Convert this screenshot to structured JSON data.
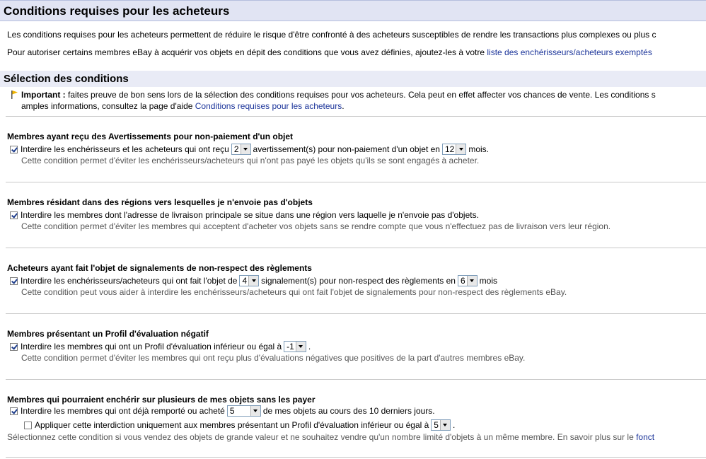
{
  "page": {
    "title": "Conditions requises pour les acheteurs",
    "intro1": "Les conditions requises pour les acheteurs permettent de réduire le risque d'être confronté à des acheteurs susceptibles de rendre les transactions plus complexes ou plus c",
    "intro2_prefix": "Pour autoriser certains membres eBay à acquérir vos objets en dépit des conditions que vous avez définies, ajoutez-les à votre ",
    "intro2_link": "liste des enchérisseurs/acheteurs exemptés"
  },
  "selection": {
    "title": "Sélection des conditions",
    "important_label": "Important :",
    "important_text": " faites preuve de bon sens lors de la sélection des conditions requises pour vos acheteurs. Cela peut en effet affecter vos chances de vente. Les conditions s",
    "important_line2_prefix": "amples informations, consultez la page d'aide ",
    "important_link": "Conditions requises pour les acheteurs",
    "important_suffix": "."
  },
  "sections": {
    "s1": {
      "title": "Membres ayant reçu des Avertissements pour non-paiement d'un objet",
      "checked": true,
      "t1": "Interdire les enchérisseurs et les acheteurs qui ont reçu",
      "v1": "2",
      "t2": "avertissement(s) pour non-paiement d'un objet en",
      "v2": "12",
      "t3": "mois.",
      "desc": "Cette condition permet d'éviter les enchérisseurs/acheteurs qui n'ont pas payé les objets qu'ils se sont engagés à acheter."
    },
    "s2": {
      "title": "Membres résidant dans des régions vers lesquelles je n'envoie pas d'objets",
      "checked": true,
      "t1": "Interdire les membres dont l'adresse de livraison principale se situe dans une région vers laquelle je n'envoie pas d'objets.",
      "desc": "Cette condition permet d'éviter les membres qui acceptent d'acheter vos objets sans se rendre compte que vous n'effectuez pas de livraison vers leur région."
    },
    "s3": {
      "title": "Acheteurs ayant fait l'objet de signalements de non-respect des règlements",
      "checked": true,
      "t1": "Interdire les enchérisseurs/acheteurs qui ont fait l'objet de",
      "v1": "4",
      "t2": "signalement(s) pour non-respect des règlements en",
      "v2": "6",
      "t3": "mois",
      "desc": "Cette condition peut vous aider à interdire les enchérisseurs/acheteurs qui ont fait l'objet de signalements pour non-respect des règlements eBay."
    },
    "s4": {
      "title": "Membres présentant un Profil d'évaluation négatif",
      "checked": true,
      "t1": "Interdire les membres qui ont un Profil d'évaluation inférieur ou égal à",
      "v1": "-1",
      "t2": ".",
      "desc": "Cette condition permet d'éviter les membres qui ont reçu plus d'évaluations négatives que positives de la part d'autres membres eBay."
    },
    "s5": {
      "title": "Membres qui pourraient enchérir sur plusieurs de mes objets sans les payer",
      "checked": true,
      "t1": "Interdire les membres qui ont déjà remporté ou acheté",
      "v1": "5",
      "t2": "de mes objets au cours des 10 derniers jours.",
      "sub_checked": false,
      "sub_t1": "Appliquer cette interdiction uniquement aux membres présentant un Profil d'évaluation inférieur ou égal à",
      "sub_v1": "5",
      "sub_t2": ".",
      "desc_prefix": "Sélectionnez cette condition si vous vendez des objets de grande valeur et ne souhaitez vendre qu'un nombre limité d'objets à un même membre. En savoir plus sur le ",
      "desc_link": "fonct"
    }
  },
  "colors": {
    "title_bg": "#e1e4f3",
    "link": "#1a3399",
    "flag": "#f0b400"
  }
}
